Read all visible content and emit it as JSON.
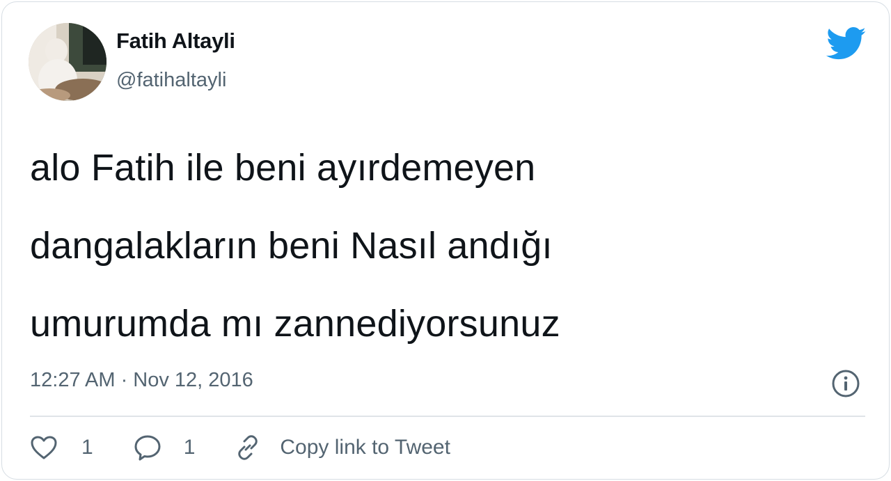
{
  "tweet": {
    "author_name": "Fatih Altayli",
    "author_handle": "@fatihaltayli",
    "text": "alo Fatih ile beni ayırdemeyen\ndangalakların beni Nasıl andığı\numurumda mı zannediyorsunuz",
    "timestamp": "12:27 AM · Nov 12, 2016"
  },
  "actions": {
    "like_count": "1",
    "reply_count": "1",
    "copy_link_label": "Copy link to Tweet"
  },
  "icons": {
    "brand": "twitter-bird-icon",
    "info": "info-icon",
    "like": "heart-icon",
    "reply": "speech-bubble-icon",
    "copy": "link-icon"
  },
  "colors": {
    "brand_blue": "#1d9bf0",
    "text_primary": "#0f1419",
    "text_secondary": "#536471",
    "border": "#d6dde3"
  }
}
